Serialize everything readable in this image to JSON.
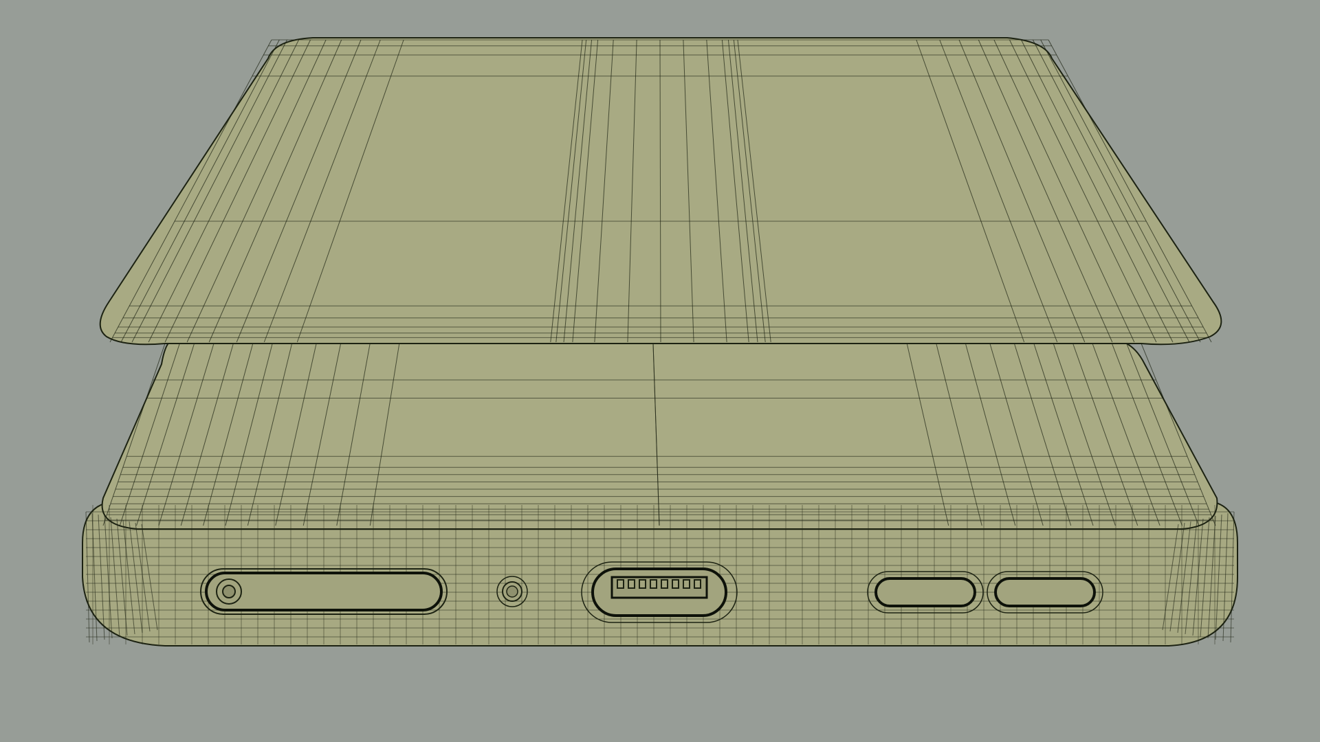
{
  "viewport": {
    "background_color": "#979d97",
    "model_fill_color": "#a8aa83",
    "model_shade_color": "#9a9c77",
    "wire_color": "#1c2212",
    "display_mode": "wireframe-shaded"
  },
  "model": {
    "parts": [
      {
        "name": "back-plate"
      },
      {
        "name": "phone-body"
      }
    ],
    "bottom_edge_features": [
      {
        "name": "sim-tray-icon"
      },
      {
        "name": "microphone-hole-icon"
      },
      {
        "name": "usb-c-port-icon"
      },
      {
        "name": "speaker-grille-left-icon"
      },
      {
        "name": "speaker-grille-right-icon"
      }
    ]
  }
}
